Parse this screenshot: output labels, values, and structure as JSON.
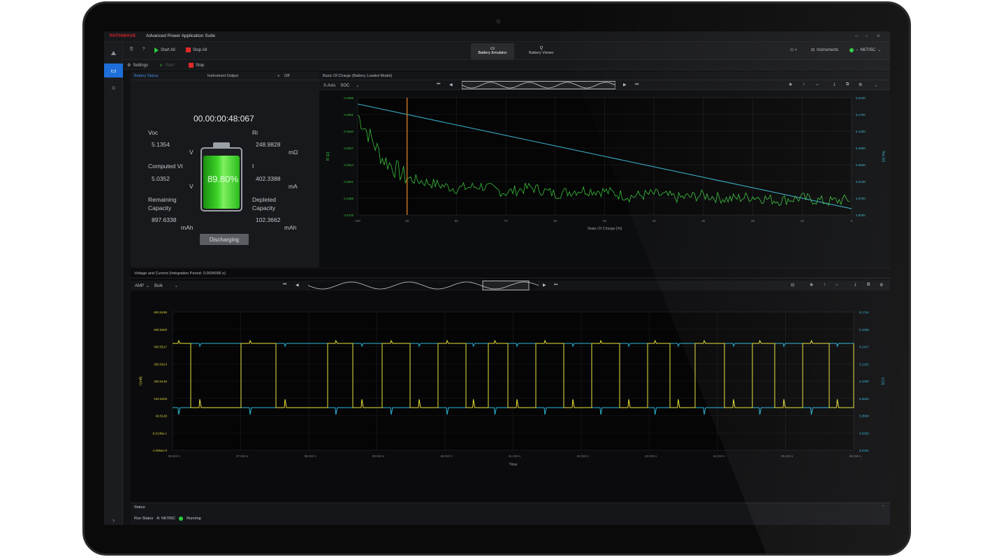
{
  "app": {
    "brand": "PATHWAVE",
    "title": "Advanced Power Application Suite"
  },
  "toolbar": {
    "start_all": "Start All",
    "stop_all": "Stop All",
    "tabs": [
      {
        "label": "Battery Emulator"
      },
      {
        "label": "Battery Viewer"
      }
    ],
    "instruments_label": "Instruments",
    "instrument_model": "N6705C"
  },
  "subbar": {
    "settings": "Settings",
    "start": "Start",
    "stop": "Stop"
  },
  "battery_panel": {
    "title": "Battery Status",
    "output_label": "Instrument Output",
    "output_state": "Off",
    "timer": "00.00:00:48:067",
    "voc_label": "Voc",
    "voc_value": "5.1354",
    "voc_unit": "V",
    "ri_label": "Ri",
    "ri_value": "248.9828",
    "ri_unit": "mΩ",
    "vt_label": "Computed Vt",
    "vt_value": "5.0352",
    "vt_unit": "V",
    "i_label": "I",
    "i_value": "402.3388",
    "i_unit": "mA",
    "remaining_label_1": "Remaining",
    "remaining_label_2": "Capacity",
    "remaining_value": "897.6338",
    "remaining_unit": "mAh",
    "depleted_label_1": "Depleted",
    "depleted_label_2": "Capacity",
    "depleted_value": "102.3662",
    "depleted_unit": "mAh",
    "battery_pct": "89.80%",
    "battery_level": 0.898,
    "status_button": "Discharging"
  },
  "soc_panel": {
    "title": "Basic Of Charge (Battery Loaded Model)",
    "x_axis_select": "X-Axis",
    "x_axis_value": "SOC",
    "xlabel": "State Of Charge [%]"
  },
  "vc_panel": {
    "title": "Voltage and Current (Integration Period: 0.0004096 s)",
    "mode_select": "AMP",
    "mode_value": "Bulk",
    "xlabel": "Time"
  },
  "status": {
    "title": "Status",
    "run_status_label": "Run Status",
    "instrument": "A: N6705C",
    "state": "Running"
  },
  "colors": {
    "accent": "#1e6fd9",
    "running": "#2ecc40",
    "soc_voltage": "#3ab5cf",
    "soc_ri": "#39c23a",
    "vc_current": "#e8e23a",
    "vc_voltage": "#2bb6d6",
    "cursor": "#f08a24"
  },
  "chart_data": [
    {
      "type": "line",
      "title": "Basic Of Charge (Battery Loaded Model)",
      "xlabel": "State Of Charge [%]",
      "ylabel_left": "Ri [Ω]",
      "ylabel_right": "Voc [V]",
      "xlim": [
        100,
        0
      ],
      "cursor_x": 90,
      "grid": true,
      "series": [
        {
          "axis": "right",
          "x": [
            100,
            90,
            80,
            70,
            60,
            50,
            40,
            30,
            20,
            10,
            0
          ],
          "values": [
            5.195,
            5.17,
            5.145,
            5.12,
            5.095,
            5.07,
            5.045,
            5.02,
            4.995,
            4.97,
            4.945
          ]
        },
        {
          "axis": "left",
          "x": [
            100,
            95,
            90,
            85,
            80,
            75,
            70,
            65,
            60,
            55,
            50,
            45,
            40,
            35,
            30,
            25,
            20,
            15,
            10,
            5,
            0
          ],
          "values": [
            0.2552,
            0.2519,
            0.2504,
            0.25,
            0.2496,
            0.2498,
            0.2493,
            0.2497,
            0.2492,
            0.2495,
            0.2494,
            0.249,
            0.2492,
            0.2489,
            0.2491,
            0.2488,
            0.249,
            0.2487,
            0.2489,
            0.2486,
            0.2488
          ]
        }
      ],
      "ylim_left": [
        0.2476,
        0.2565
      ],
      "ylim_right": [
        4.93,
        5.21
      ]
    },
    {
      "type": "line",
      "title": "Voltage and Current (Integration Period: 0.0004096 s)",
      "xlabel": "Time",
      "ylabel_left": "I [mA]",
      "ylabel_right": "V [V]",
      "grid": true,
      "series": [
        {
          "axis": "left",
          "kind": "pulsed-current",
          "high": 330,
          "low": 28,
          "peak": 390,
          "transitions": 32
        },
        {
          "axis": "right",
          "kind": "pulsed-voltage",
          "high": 5.15,
          "low": 5.03,
          "transitions": 32
        }
      ]
    }
  ]
}
